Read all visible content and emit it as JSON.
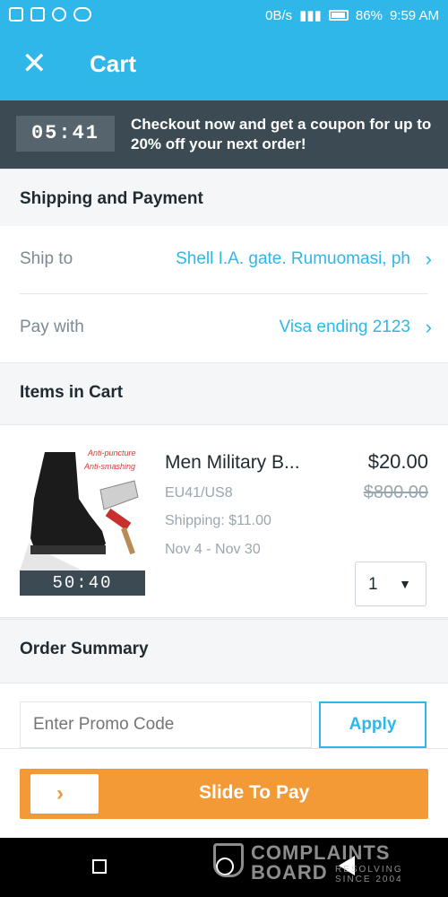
{
  "status_bar": {
    "network": "0B/s",
    "battery": "86%",
    "time": "9:59 AM"
  },
  "header": {
    "title": "Cart"
  },
  "promo_banner": {
    "timer": "05:41",
    "message": "Checkout now and get a coupon for up to 20% off your next order!"
  },
  "shipping_payment": {
    "heading": "Shipping and Payment",
    "ship_label": "Ship to",
    "ship_value": "Shell I.A. gate. Rumuomasi, ph",
    "pay_label": "Pay with",
    "pay_value": "Visa ending 2123"
  },
  "cart": {
    "heading": "Items in Cart",
    "item": {
      "timer": "50:40",
      "image_text_1": "Anti-puncture",
      "image_text_2": "Anti-smashing",
      "name": "Men Military B...",
      "variant": "EU41/US8",
      "shipping": "Shipping: $11.00",
      "dates": "Nov 4 - Nov 30",
      "price": "$20.00",
      "original_price": "$800.00",
      "quantity": "1"
    }
  },
  "order_summary": {
    "heading": "Order Summary",
    "promo_placeholder": "Enter Promo Code",
    "apply_label": "Apply"
  },
  "pay_bar": {
    "label": "Slide To Pay"
  },
  "watermark": {
    "line1": "COMPLAINTS",
    "line2": "BOARD",
    "tagline": "RESOLVING SINCE 2004"
  }
}
